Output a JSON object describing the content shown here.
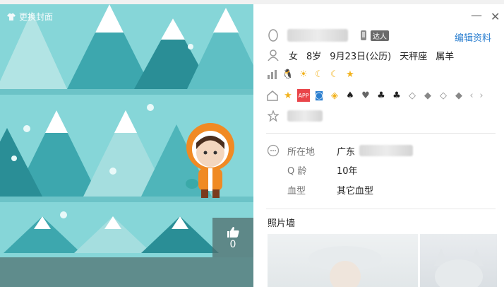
{
  "cover": {
    "change_cover_label": "更换封面",
    "like_count": "0"
  },
  "header": {
    "badge_text": "达人",
    "edit_label": "编辑资料"
  },
  "facts": {
    "gender": "女",
    "age": "8岁",
    "birthday": "9月23日(公历)",
    "zodiac": "天秤座",
    "animal": "属羊"
  },
  "info": {
    "location_label": "所在地",
    "location_value": "广东",
    "qage_label": "Q 龄",
    "qage_value": "10年",
    "blood_label": "血型",
    "blood_value": "其它血型"
  },
  "photo_wall_title": "照片墙",
  "colors": {
    "accent": "#2b7fd0",
    "cover_bg": "#7fd0d4"
  }
}
